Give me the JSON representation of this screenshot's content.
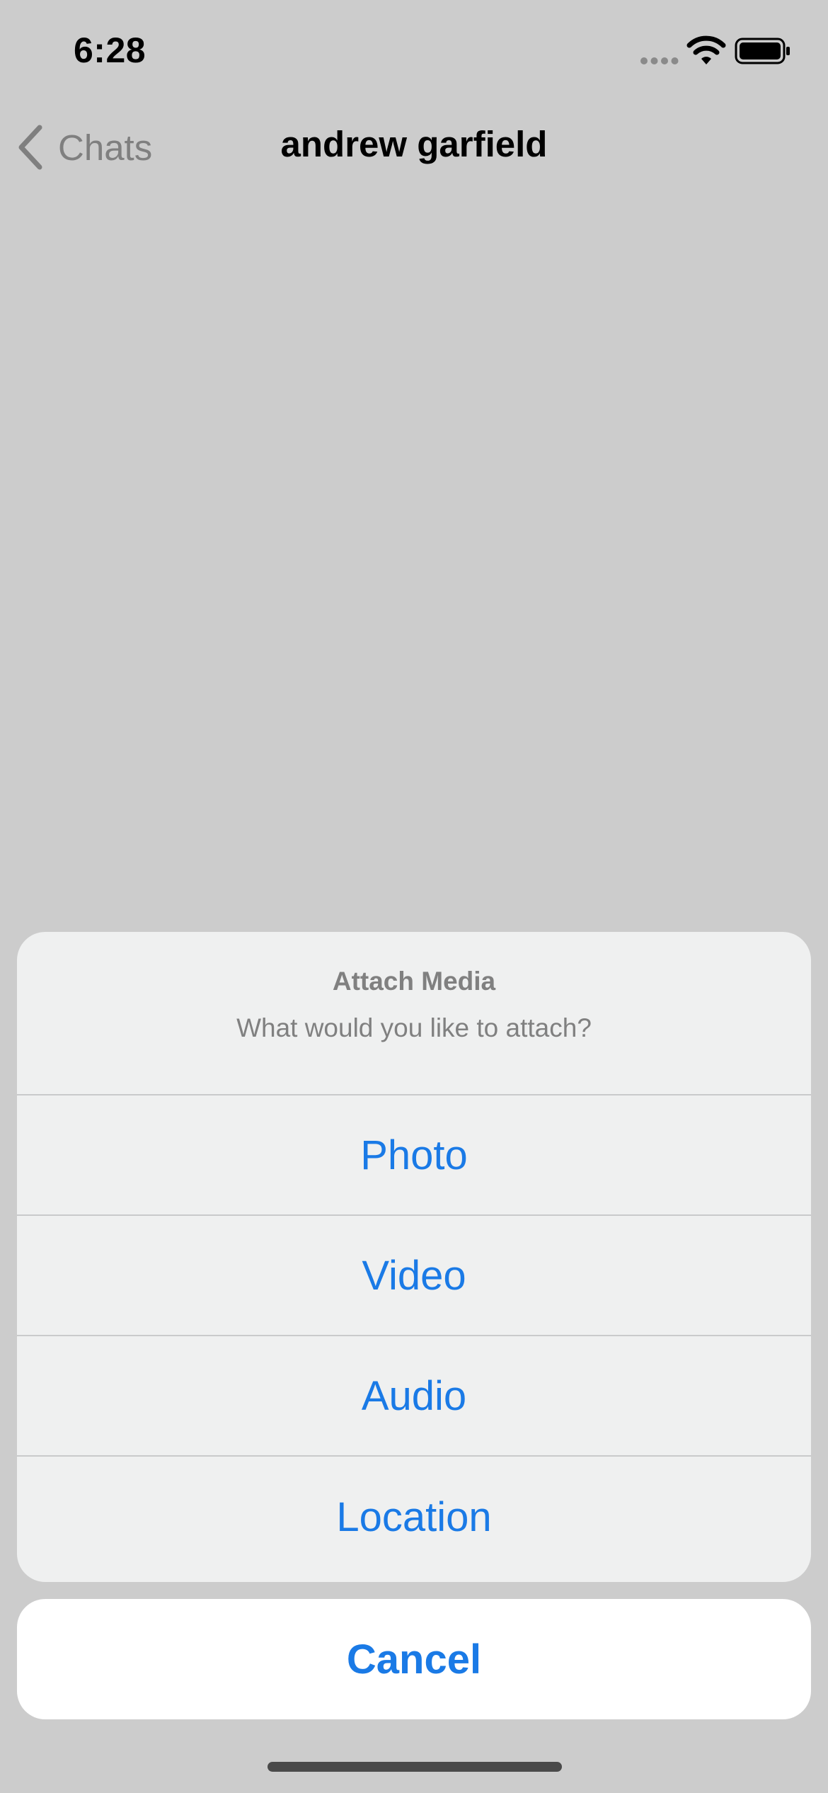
{
  "status_bar": {
    "time": "6:28"
  },
  "nav": {
    "back_label": "Chats",
    "title": "andrew garfield"
  },
  "action_sheet": {
    "title": "Attach Media",
    "message": "What would you like to attach?",
    "actions": [
      {
        "label": "Photo"
      },
      {
        "label": "Video"
      },
      {
        "label": "Audio"
      },
      {
        "label": "Location"
      }
    ],
    "cancel_label": "Cancel"
  },
  "colors": {
    "background_dim": "#cccccc",
    "sheet_background": "#eff0f0",
    "action_blue": "#1a7ae6",
    "secondary_text": "#808080"
  },
  "icons": {
    "back": "chevron-left-icon",
    "signal": "cellular-signal-icon",
    "wifi": "wifi-icon",
    "battery": "battery-icon"
  }
}
